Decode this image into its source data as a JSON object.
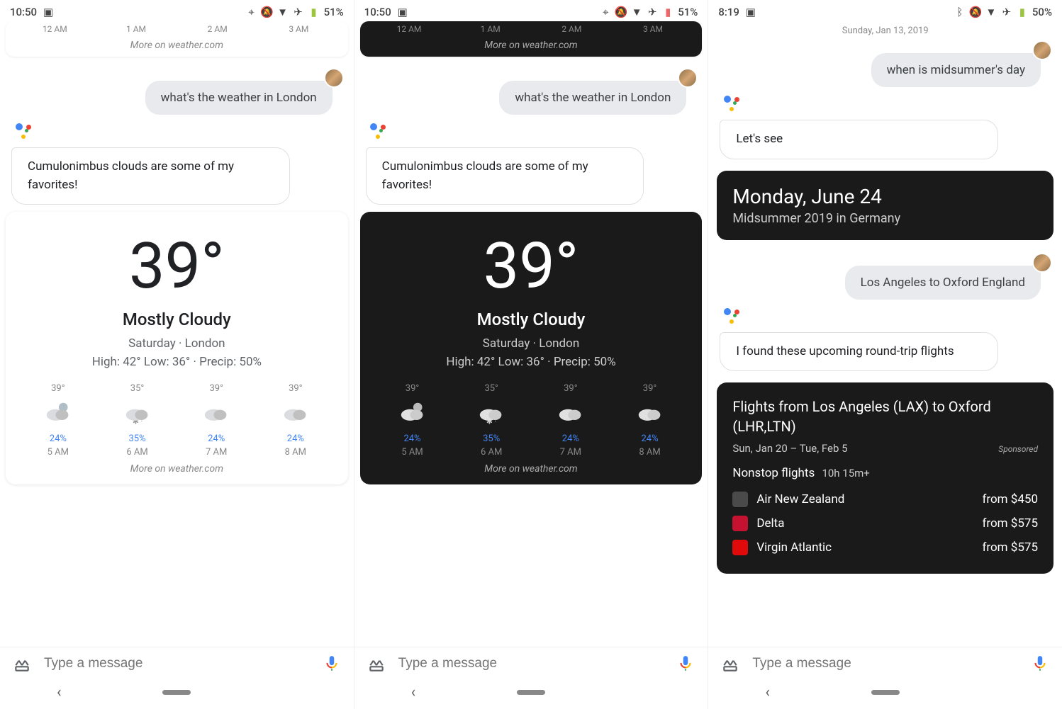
{
  "screens": [
    {
      "status": {
        "time": "10:50",
        "battery": "51%"
      },
      "top_hours": [
        "12 AM",
        "1 AM",
        "2 AM",
        "3 AM"
      ],
      "top_more": "More on weather.com",
      "user_msg": "what's the weather in London",
      "asst_msg": "Cumulonimbus clouds are some of my favorites!",
      "weather": {
        "temp": "39°",
        "cond": "Mostly Cloudy",
        "loc": "Saturday · London",
        "hilo": "High: 42° Low: 36° · Precip: 50%",
        "more": "More on weather.com",
        "hours": [
          {
            "t": "39°",
            "p": "24%",
            "h": "5 AM",
            "type": "moon"
          },
          {
            "t": "35°",
            "p": "35%",
            "h": "6 AM",
            "type": "snow"
          },
          {
            "t": "39°",
            "p": "24%",
            "h": "7 AM",
            "type": "cloud"
          },
          {
            "t": "39°",
            "p": "24%",
            "h": "8 AM",
            "type": "cloud"
          }
        ]
      },
      "input_placeholder": "Type a message",
      "theme": "light"
    },
    {
      "status": {
        "time": "10:50",
        "battery": "51%"
      },
      "top_hours": [
        "12 AM",
        "1 AM",
        "2 AM",
        "3 AM"
      ],
      "top_more": "More on weather.com",
      "user_msg": "what's the weather in London",
      "asst_msg": "Cumulonimbus clouds are some of my favorites!",
      "weather": {
        "temp": "39°",
        "cond": "Mostly Cloudy",
        "loc": "Saturday · London",
        "hilo": "High: 42° Low: 36° · Precip: 50%",
        "more": "More on weather.com",
        "hours": [
          {
            "t": "39°",
            "p": "24%",
            "h": "5 AM",
            "type": "moon"
          },
          {
            "t": "35°",
            "p": "35%",
            "h": "6 AM",
            "type": "snow"
          },
          {
            "t": "39°",
            "p": "24%",
            "h": "7 AM",
            "type": "cloud"
          },
          {
            "t": "39°",
            "p": "24%",
            "h": "8 AM",
            "type": "cloud"
          }
        ]
      },
      "input_placeholder": "Type a message",
      "theme": "dark"
    },
    {
      "status": {
        "time": "8:19",
        "battery": "50%"
      },
      "date_header": "Sunday, Jan 13, 2019",
      "user_msg1": "when is midsummer's day",
      "asst_msg1": "Let's see",
      "date_card": {
        "title": "Monday, June 24",
        "sub": "Midsummer 2019 in Germany"
      },
      "user_msg2": "Los Angeles to Oxford England",
      "asst_msg2": "I found these upcoming round-trip flights",
      "flights": {
        "title": "Flights from Los Angeles (LAX) to Oxford (LHR,LTN)",
        "date": "Sun, Jan 20 – Tue, Feb 5",
        "sponsored": "Sponsored",
        "nonstop": "Nonstop flights",
        "duration": "10h 15m+",
        "rows": [
          {
            "name": "Air New Zealand",
            "price": "from $450",
            "color": "#4a4a4a"
          },
          {
            "name": "Delta",
            "price": "from $575",
            "color": "#c41230"
          },
          {
            "name": "Virgin Atlantic",
            "price": "from $575",
            "color": "#e10a0a"
          }
        ]
      },
      "input_placeholder": "Type a message"
    }
  ]
}
